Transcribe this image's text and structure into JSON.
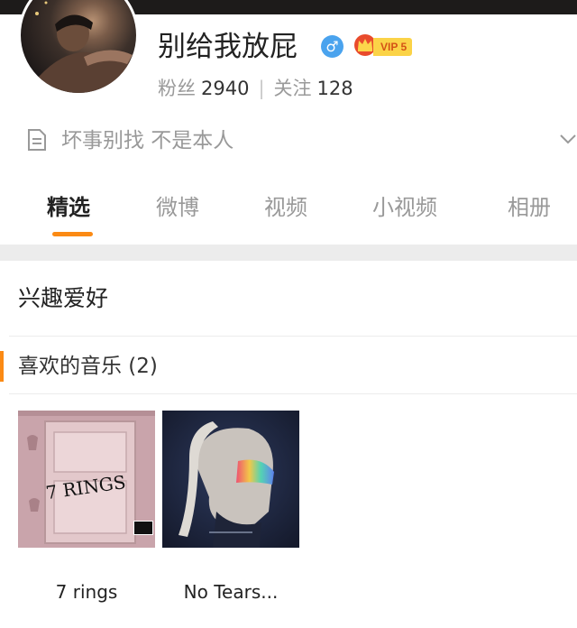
{
  "profile": {
    "name": "别给我放屁",
    "gender_symbol": "♂",
    "vip_label": "VIP 5",
    "followers_label": "粉丝",
    "followers_count": "2940",
    "following_label": "关注",
    "following_count": "128",
    "bio": "坏事别找 不是本人"
  },
  "tabs": [
    {
      "label": "精选",
      "active": true
    },
    {
      "label": "微博",
      "active": false
    },
    {
      "label": "视频",
      "active": false
    },
    {
      "label": "小视频",
      "active": false
    },
    {
      "label": "相册",
      "active": false
    }
  ],
  "section": {
    "title": "兴趣爱好",
    "music_title": "喜欢的音乐 (2)"
  },
  "albums": [
    {
      "title": "7 rings",
      "cover_text": "7 RINGS"
    },
    {
      "title": "No Tears..."
    }
  ],
  "colors": {
    "accent": "#fb8a14",
    "gender_badge": "#4aa3ee",
    "vip_badge": "#fbd347"
  }
}
